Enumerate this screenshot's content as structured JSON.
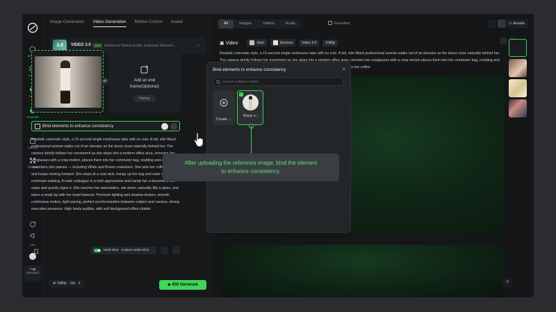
{
  "nav": {
    "items": [
      {
        "label": "Explore"
      },
      {
        "label": "Assets"
      },
      {
        "label": "Omni"
      },
      {
        "label": "Generate"
      },
      {
        "label": "Canvas"
      },
      {
        "label": "All Tools"
      }
    ],
    "language": "API",
    "credits": "7.5k",
    "plan": "Standard"
  },
  "panel": {
    "tabs": [
      "Image Generation",
      "Video Generation",
      "Motion Control",
      "Avatar"
    ],
    "active_tab": "Video Generation",
    "model_thumb": "3.0",
    "model_name": "VIDEO 3.0",
    "model_badge": "NEW",
    "model_desc": "Enhanced Native Audio, Improved Element...",
    "end_frame_label_1": "Add an end",
    "end_frame_label_2": "frame(Optional)",
    "history_label": "History",
    "bind_label": "Bind elements to enhance consistency",
    "prompt": "Realistic cinematic style, a 15-second single continuous take with no cuts. A tall, slim Black professional woman walks out of an elevator as the doors close naturally behind her. The camera strictly follows her movement as she steps into a modern office area, removes her sunglasses with a crisp motion, places them into her commuter bag, nodding and smiling to coworkers she passes — including White and Brown coworkers. She sets her coffee down and keeps moving forward. She stops at a coat rack, hangs up her bag and outer coat, then continues walking. A male colleague in a shirt approaches and hands her a document; she stops and quickly signs it. She reaches her workstation, sits down, naturally lifts a glass, and takes a small sip with her head lowered. Premium lighting and shadow texture, smooth continuous motion, tight pacing, perfect synchronization between subject and camera, strong executive presence. High heels audible, with soft background office chatter.",
    "multishot_label": "Multi-Shot",
    "custom_multishot_label": "Custom Multi-Shot",
    "settings": "1080p · 15s · 2",
    "generate_cost": "450",
    "generate_label": "Generate"
  },
  "main": {
    "filters": [
      "All",
      "Images",
      "Videos",
      "Audio"
    ],
    "active_filter": "All",
    "favorites_label": "Favorites",
    "assets_label": "Assets",
    "video_title": "Video",
    "chips": [
      "Start",
      "Element",
      "Video 3.0",
      "1080p"
    ],
    "video_prompt": "Realistic cinematic style, a 15-second single continuous take with no cuts. A tall, slim Black professional woman walks out of an elevator as the doors close naturally behind her. The camera strictly follows her movement as she steps into a modern office area, removes her sunglasses with a crisp motion places them into her commuter bag, nodding and smiling to coworkers she passes — including White and Brown coworkers. She sets her coffee"
  },
  "modal": {
    "title": "Bind elements to enhance consistency",
    "search_placeholder": "search-subject-name",
    "create_label": "Create ...",
    "element_label": "Black s..."
  },
  "tooltip": {
    "line1": "After uploading the reference image, bind the element",
    "line2": "to enhance consistency."
  },
  "colors": {
    "accent": "#3fcf55",
    "background": "#121416",
    "panel": "#161819"
  }
}
